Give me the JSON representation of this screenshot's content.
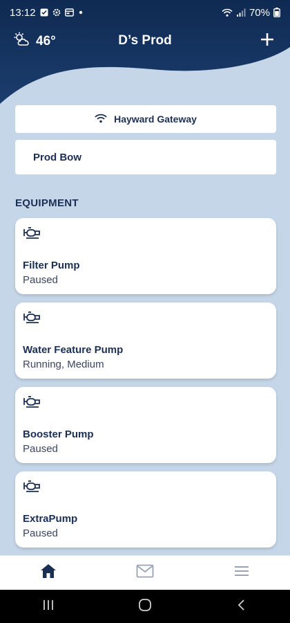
{
  "status_bar": {
    "time": "13:12",
    "battery": "70%"
  },
  "header": {
    "temperature": "46°",
    "title": "D’s Prod",
    "weather_icon": "partly-cloudy-icon",
    "add_icon": "plus-icon"
  },
  "gateway": {
    "label": "Hayward Gateway",
    "icon": "wifi-icon"
  },
  "body_of_water": {
    "label": "Prod Bow"
  },
  "equipment": {
    "section_title": "EQUIPMENT",
    "items": [
      {
        "name": "Filter Pump",
        "status": "Paused",
        "icon": "pump-icon"
      },
      {
        "name": "Water Feature Pump",
        "status": "Running, Medium",
        "icon": "pump-icon"
      },
      {
        "name": "Booster Pump",
        "status": "Paused",
        "icon": "pump-icon"
      },
      {
        "name": "ExtraPump",
        "status": "Paused",
        "icon": "pump-icon"
      }
    ]
  },
  "bottom_nav": {
    "items": [
      {
        "icon": "home-icon",
        "active": true
      },
      {
        "icon": "mail-icon",
        "active": false
      },
      {
        "icon": "menu-icon",
        "active": false
      }
    ]
  },
  "colors": {
    "header_dark": "#13305a",
    "background": "#c5d6e8",
    "text_dark": "#1b2f55"
  }
}
